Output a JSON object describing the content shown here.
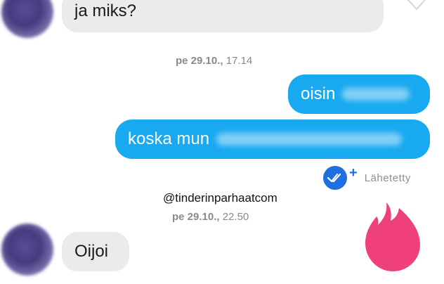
{
  "messages": {
    "incoming_1": "ja miks?",
    "timestamp_1_date": "pe 29.10.,",
    "timestamp_1_time": "17.14",
    "outgoing_1": "oisin",
    "outgoing_2": "koska mun",
    "status": "Lähetetty",
    "timestamp_2_date": "pe 29.10.,",
    "timestamp_2_time": "22.50",
    "incoming_2": "Oijoi"
  },
  "watermark": "@tinderinparhaatcom",
  "colors": {
    "outgoing_bubble": "#19a9f0",
    "incoming_bubble": "#ebebeb",
    "status_check": "#1f6fe0",
    "tinder_flame": "#f0407a"
  },
  "icons": [
    "heart-icon",
    "double-check-icon",
    "plus-icon",
    "tinder-flame-icon"
  ]
}
